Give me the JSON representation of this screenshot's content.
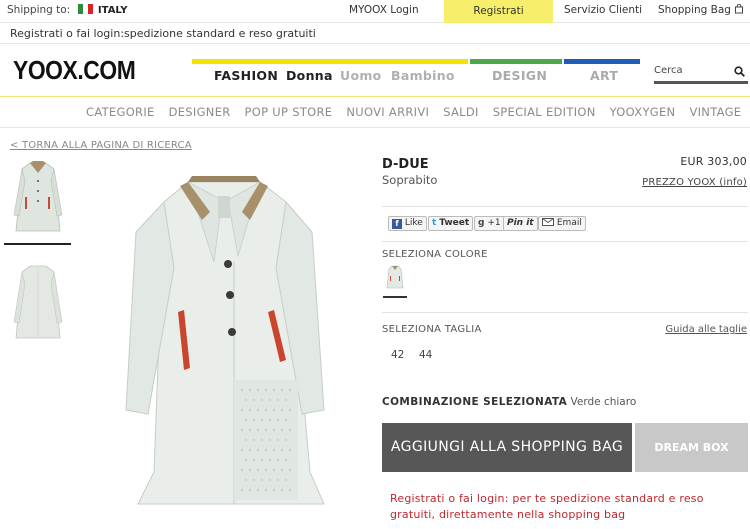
{
  "topbar": {
    "shipping_label": "Shipping to:",
    "country": "ITALY",
    "login": "MYOOX Login",
    "register": "Registrati",
    "service": "Servizio Clienti",
    "bag": "Shopping Bag"
  },
  "promo": "Registrati o fai login:spedizione standard e reso gratuiti",
  "header": {
    "logo": "YOOX.COM",
    "nav": {
      "fashion": "FASHION",
      "donna": "Donna",
      "uomo": "Uomo",
      "bambino": "Bambino",
      "design": "DESIGN",
      "art": "ART"
    },
    "search_label": "Cerca",
    "colors": {
      "fashion": "#f3e300",
      "design": "#4aa84a",
      "art": "#1d5fb4"
    }
  },
  "categories": [
    "CATEGORIE",
    "DESIGNER",
    "POP UP STORE",
    "NUOVI ARRIVI",
    "SALDI",
    "SPECIAL EDITION",
    "YOOXYGEN",
    "VINTAGE"
  ],
  "back_link": "< TORNA ALLA PAGINA DI RICERCA",
  "product": {
    "brand": "D-DUE",
    "type": "Soprabito",
    "price": "EUR 303,00",
    "price_link": "PREZZO YOOX (info)",
    "social": {
      "like": "Like",
      "tweet": "Tweet",
      "plusone": "+1",
      "pinit": "Pin it",
      "email": "Email"
    },
    "color_label": "SELEZIONA COLORE",
    "size_label": "SELEZIONA TAGLIA",
    "size_guide": "Guida alle taglie",
    "sizes": [
      "42",
      "44"
    ],
    "combo_label": "COMBINAZIONE SELEZIONATA",
    "combo_value": "Verde chiaro",
    "add_button": "AGGIUNGI ALLA SHOPPING BAG",
    "dream_button": "DREAM BOX",
    "note": "Registrati o fai login: per te spedizione standard e reso gratuiti, direttamente nella shopping bag"
  }
}
